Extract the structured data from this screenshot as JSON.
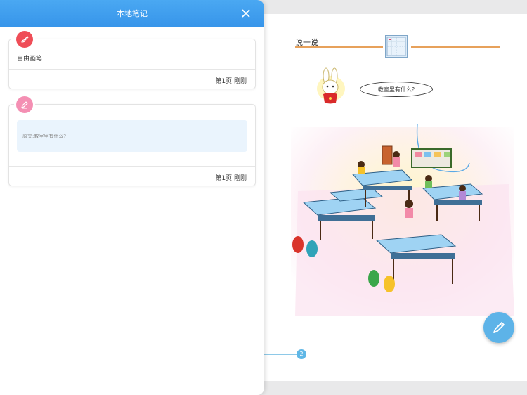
{
  "panel": {
    "title": "本地笔记",
    "close_icon": "close-icon"
  },
  "notes": [
    {
      "type_icon": "brush-icon",
      "badge_color": "#ef4d57",
      "title": "自由画笔",
      "meta": "第1页 刚刚"
    },
    {
      "type_icon": "pencil-icon",
      "badge_color": "#f48fb3",
      "quote": "原文:教室里有什么?",
      "meta": "第1页 刚刚"
    }
  ],
  "book": {
    "section_title": "说一说",
    "speech_bubble": "教室里有什么?",
    "page_number": "2"
  },
  "colors": {
    "header_blue": "#3795ea",
    "accent_orange": "#e7a15b",
    "fab_blue": "#5db3e8"
  }
}
